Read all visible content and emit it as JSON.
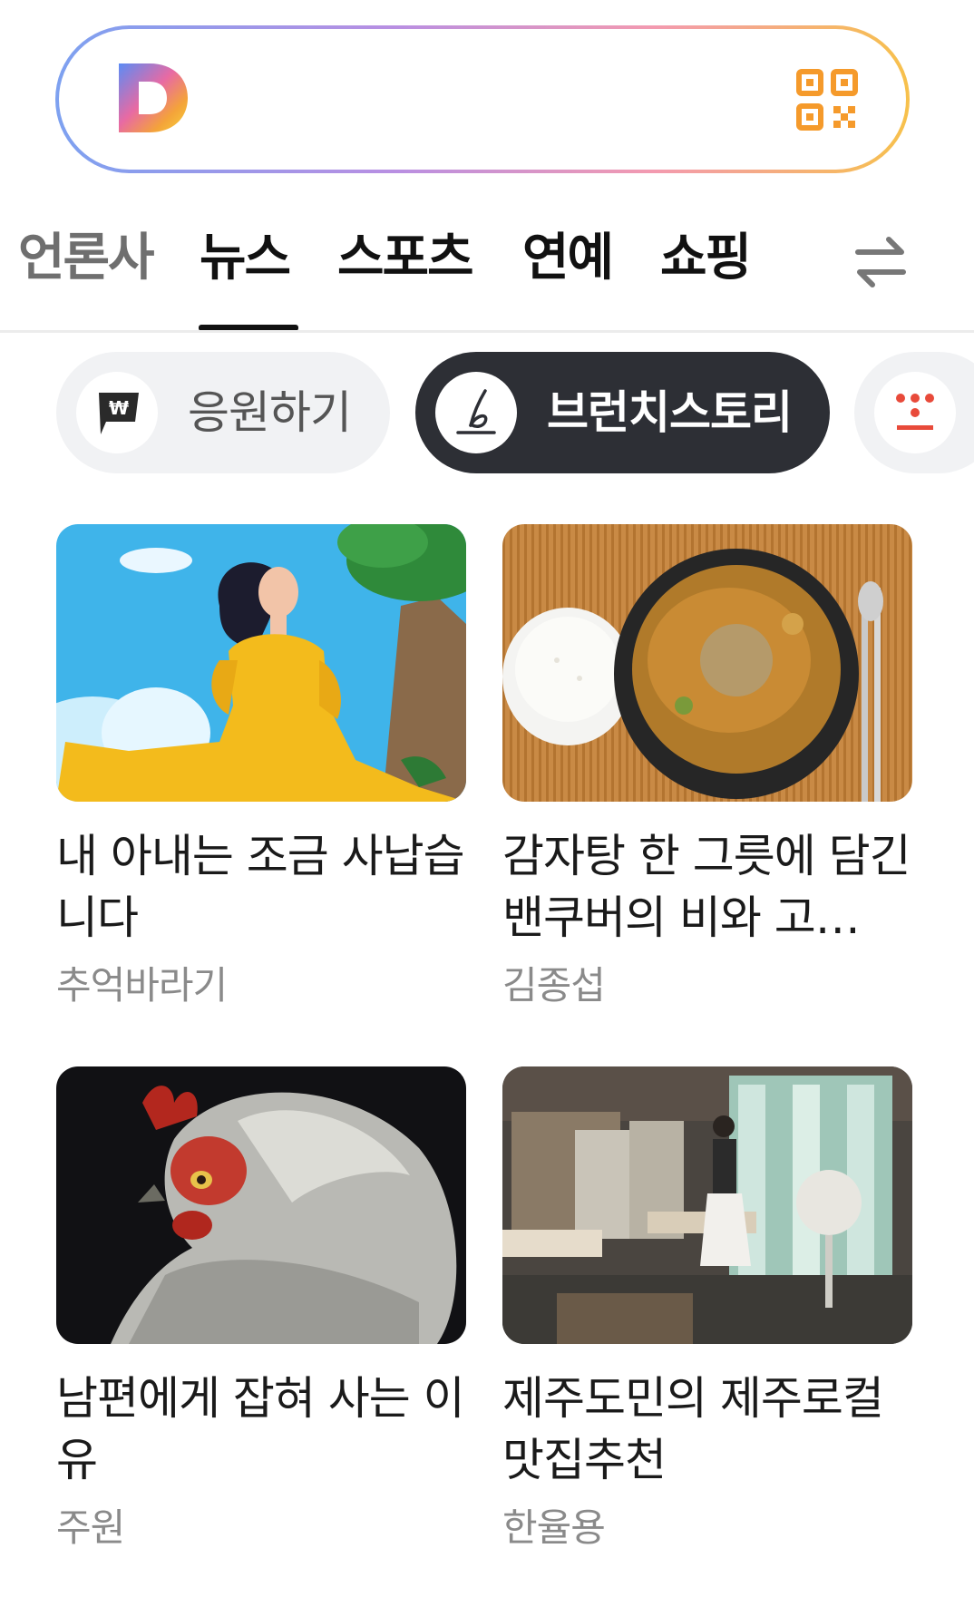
{
  "colors": {
    "accent_dark": "#2d2f35",
    "search_border_gradient": [
      "#7da1f0",
      "#b98fe2",
      "#f39ab0",
      "#f7c14b"
    ],
    "qr_orange": "#f59a2b"
  },
  "search": {
    "logo_icon": "daum-logo-icon",
    "qr_icon": "qr-code-icon"
  },
  "tabs": [
    {
      "label": "언론사",
      "active": false
    },
    {
      "label": "뉴스",
      "active": true
    },
    {
      "label": "스포츠",
      "active": false
    },
    {
      "label": "연예",
      "active": false
    },
    {
      "label": "쇼핑",
      "active": false
    }
  ],
  "tabs_edit_icon": "swap-arrows-icon",
  "chips": [
    {
      "label": "응원하기",
      "icon": "won-flag-icon",
      "selected": false
    },
    {
      "label": "브런치스토리",
      "icon": "brunch-pen-icon",
      "selected": true
    },
    {
      "label": "",
      "icon": "dots-logo-icon",
      "selected": false
    }
  ],
  "cards": [
    {
      "title": "내 아내는 조금 사납습니다",
      "author": "추억바라기",
      "image": "woman-yellow-dress-illustration"
    },
    {
      "title": "감자탕 한 그릇에 담긴 밴쿠버의 비와 고…",
      "author": "김종섭",
      "image": "potato-stew-and-rice"
    },
    {
      "title": "남편에게 잡혀 사는 이유",
      "author": "주원",
      "image": "chicken-portrait"
    },
    {
      "title": "제주도민의 제주로컬 맛집추천",
      "author": "한율용",
      "image": "restaurant-interior"
    }
  ]
}
